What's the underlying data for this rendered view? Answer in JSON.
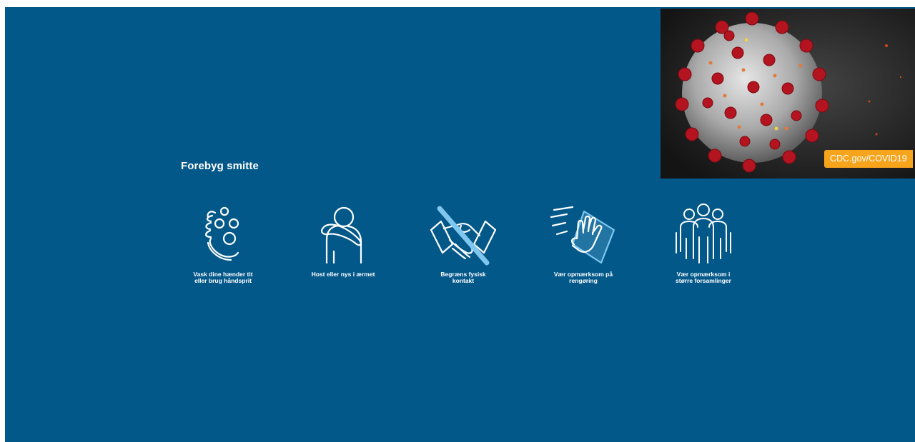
{
  "slide": {
    "title": "Forebyg smitte",
    "background_color": "#03588a",
    "items": [
      {
        "icon": "hand-wash-icon",
        "label": "Vask dine hænder tit\neller brug håndsprit"
      },
      {
        "icon": "cough-sleeve-icon",
        "label": "Host eller nys i ærmet"
      },
      {
        "icon": "no-handshake-icon",
        "label": "Begræns fysisk\nkontakt"
      },
      {
        "icon": "cleaning-icon",
        "label": "Vær opmærksom på\nrengøring"
      },
      {
        "icon": "crowd-icon",
        "label": "Vær opmærksom i\nstørre forsamlinger"
      }
    ]
  },
  "photo": {
    "subject": "coronavirus-illustration",
    "credit": "CDC.gov/COVID19",
    "credit_color": "#f7a41d"
  }
}
